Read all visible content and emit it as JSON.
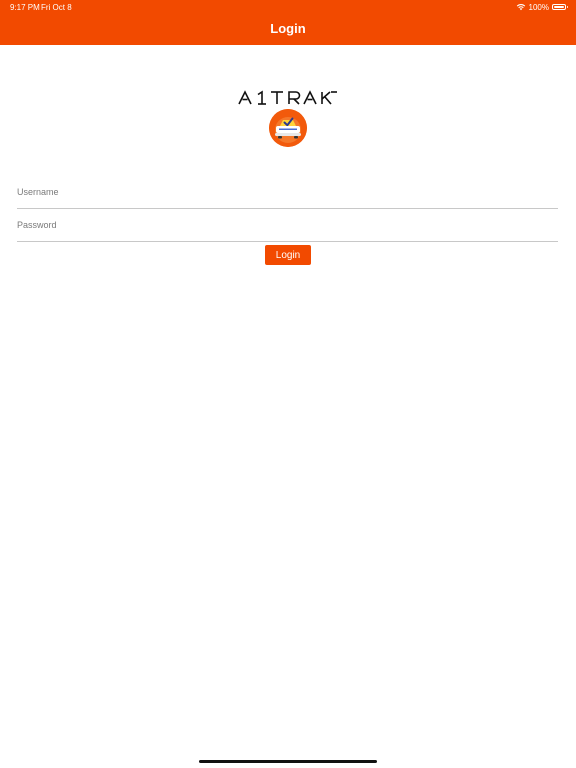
{
  "status_bar": {
    "time": "9:17 PM",
    "date": "Fri Oct 8",
    "battery": "100%",
    "wifi_icon": "wifi-icon",
    "battery_icon": "battery-icon"
  },
  "nav": {
    "title": "Login"
  },
  "brand": {
    "logo_text": "AITRAK",
    "badge_icon": "car-check-icon"
  },
  "form": {
    "username_placeholder": "Username",
    "username_value": "",
    "password_placeholder": "Password",
    "password_value": "",
    "login_label": "Login"
  },
  "colors": {
    "accent": "#f24a00",
    "background": "#ffffff",
    "field_underline": "#c8c8c8",
    "placeholder": "#7a7a7a"
  }
}
